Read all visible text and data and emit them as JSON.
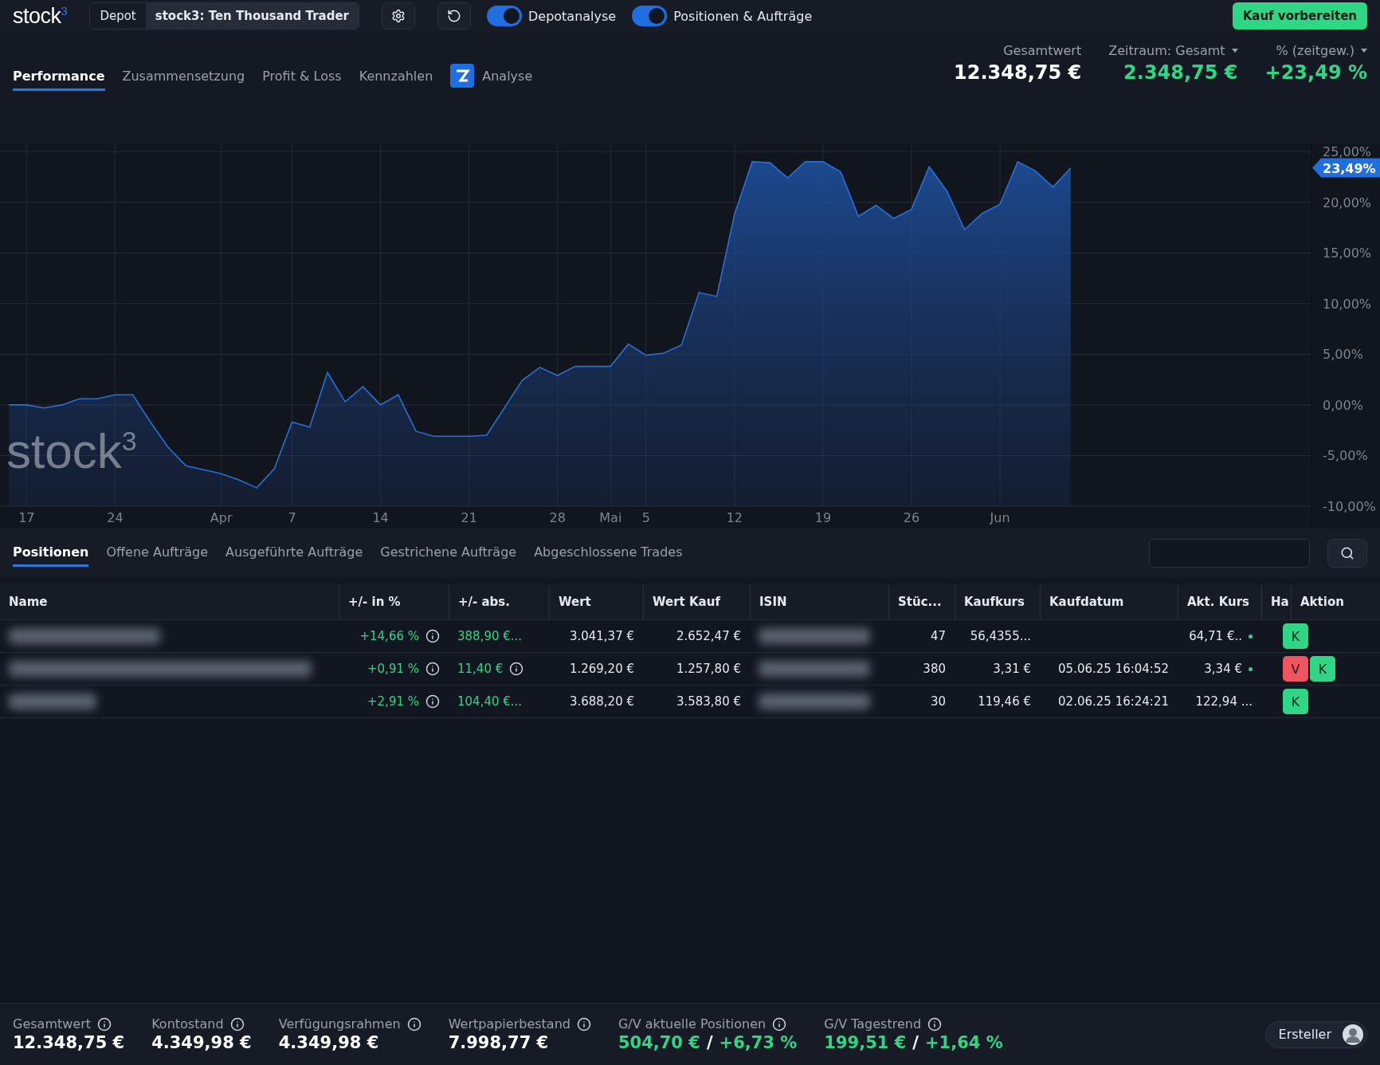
{
  "logo": "stock$^{3}$",
  "depot": {
    "label": "Depot",
    "value": "stock3: Ten Thousand Trader"
  },
  "toggles": [
    {
      "label": "Depotanalyse",
      "on": true
    },
    {
      "label": "Positionen & Aufträge",
      "on": true
    }
  ],
  "primary_button": "Kauf vorbereiten",
  "tabs": [
    {
      "label": "Performance",
      "selected": true,
      "icon": false
    },
    {
      "label": "Zusammensetzung",
      "selected": false,
      "icon": false
    },
    {
      "label": "Profit & Loss",
      "selected": false,
      "icon": false
    },
    {
      "label": "Kennzahlen",
      "selected": false,
      "icon": false
    },
    {
      "label": "Analyse",
      "selected": false,
      "icon": true
    }
  ],
  "summary": [
    {
      "label": "Gesamtwert",
      "dropdown": false,
      "value": "12.348,75 €",
      "positive": false
    },
    {
      "label": "Zeitraum: Gesamt",
      "dropdown": true,
      "value": "2.348,75 €",
      "positive": true
    },
    {
      "label": "% (zeitgew.)",
      "dropdown": true,
      "value": "+23,49 %",
      "positive": true
    }
  ],
  "chart_watermark": "stock$^{3}$",
  "chart_current_label": "23,49%",
  "chart_data": {
    "type": "line",
    "grid": true,
    "ylim": [
      -10,
      25.8
    ],
    "categories": [
      null,
      "17",
      null,
      null,
      null,
      null,
      "24",
      null,
      null,
      null,
      null,
      null,
      "Apr",
      null,
      null,
      null,
      "7",
      null,
      null,
      null,
      null,
      "14",
      null,
      null,
      null,
      null,
      "21",
      null,
      null,
      null,
      null,
      "28",
      null,
      null,
      "Mai",
      null,
      "5",
      null,
      null,
      null,
      null,
      "12",
      null,
      null,
      null,
      null,
      "19",
      null,
      null,
      null,
      null,
      "26",
      null,
      null,
      null,
      null,
      "Jun",
      null,
      null,
      null,
      null
    ],
    "series": [
      {
        "color": "#2a6fd6",
        "values": [
          0,
          0,
          -0.3,
          0,
          0.6,
          0.6,
          1.0,
          1.0,
          -1.7,
          -4.2,
          -6.0,
          -6.4,
          -6.8,
          -7.4,
          -8.2,
          -6.3,
          -1.7,
          -2.2,
          3.2,
          0.3,
          1.8,
          0,
          1.0,
          -2.6,
          -3.1,
          -3.1,
          -3.1,
          -3.0,
          -0.3,
          2.4,
          3.7,
          2.9,
          3.8,
          3.8,
          3.8,
          6.0,
          4.9,
          5.1,
          5.9,
          11.1,
          10.7,
          18.8,
          24.0,
          23.9,
          22.4,
          24.0,
          24.0,
          23.0,
          18.6,
          19.7,
          18.4,
          19.3,
          23.5,
          21.1,
          17.3,
          18.9,
          19.8,
          24.0,
          23.1,
          21.5,
          23.4
        ]
      }
    ],
    "yticks": [
      {
        "value": 25,
        "label": "25,00%"
      },
      {
        "value": 20,
        "label": "20,00%"
      },
      {
        "value": 15,
        "label": "15,00%"
      },
      {
        "value": 10,
        "label": "10,00%"
      },
      {
        "value": 5,
        "label": "5,00%"
      },
      {
        "value": 0,
        "label": "0,00%"
      },
      {
        "value": -5,
        "label": "-5,00%"
      },
      {
        "value": -10,
        "label": "-10,00%"
      }
    ]
  },
  "order_tabs": [
    {
      "label": "Positionen",
      "selected": true
    },
    {
      "label": "Offene Aufträge",
      "selected": false
    },
    {
      "label": "Ausgeführte Aufträge",
      "selected": false
    },
    {
      "label": "Gestrichene Aufträge",
      "selected": false
    },
    {
      "label": "Abgeschlossene Trades",
      "selected": false
    }
  ],
  "table": {
    "columns": [
      "Name",
      "+/- in %",
      "+/- abs.",
      "Wert",
      "Wert Kauf",
      "ISIN",
      "Stüc...",
      "Kaufkurs",
      "Kaufdatum",
      "Akt. Kurs",
      "Ha",
      "Aktion"
    ],
    "rows": [
      {
        "name_redacted": true,
        "pct": {
          "text": "+14,66 %",
          "info": true
        },
        "abs": {
          "text": "388,90 €...",
          "info": false
        },
        "wert": "3.041,37 €",
        "wert_kauf": "2.652,47 €",
        "isin_redacted": true,
        "stueck": "47",
        "kaufkurs": "56,4355...",
        "akt_kurs": "64,71 €..",
        "dot": true,
        "actions": [
          {
            "label": "K",
            "kind": "buy"
          }
        ]
      },
      {
        "name_redacted": true,
        "pct": {
          "text": "+0,91 %",
          "info": true
        },
        "abs": {
          "text": "11,40 €",
          "info": true
        },
        "wert": "1.269,20 €",
        "wert_kauf": "1.257,80 €",
        "isin_redacted": true,
        "stueck": "380",
        "kaufkurs": "3,31 €",
        "kaufdatum": "05.06.25 16:04:52",
        "akt_kurs": "3,34 €",
        "dot": true,
        "actions": [
          {
            "label": "V",
            "kind": "sell"
          },
          {
            "label": "K",
            "kind": "buy"
          }
        ]
      },
      {
        "name_redacted": true,
        "pct": {
          "text": "+2,91 %",
          "info": true
        },
        "abs": {
          "text": "104,40 €...",
          "info": false
        },
        "wert": "3.688,20 €",
        "wert_kauf": "3.583,80 €",
        "isin_redacted": true,
        "stueck": "30",
        "kaufkurs": "119,46 €",
        "kaufdatum": "02.06.25 16:24:21",
        "akt_kurs": "122,94 ...",
        "dot": false,
        "actions": [
          {
            "label": "K",
            "kind": "buy"
          }
        ]
      }
    ]
  },
  "footer": [
    {
      "label": "Gesamtwert",
      "values": [
        {
          "text": "12.348,75 €",
          "positive": false
        }
      ]
    },
    {
      "label": "Kontostand",
      "values": [
        {
          "text": "4.349,98 €",
          "positive": false
        }
      ]
    },
    {
      "label": "Verfügungsrahmen",
      "values": [
        {
          "text": "4.349,98 €",
          "positive": false
        }
      ]
    },
    {
      "label": "Wertpapierbestand",
      "values": [
        {
          "text": "7.998,77 €",
          "positive": false
        }
      ]
    },
    {
      "label": "G/V aktuelle Positionen",
      "values": [
        {
          "text": "504,70 €",
          "positive": true
        },
        {
          "text": "/",
          "positive": false
        },
        {
          "text": "+6,73 %",
          "positive": true
        }
      ]
    },
    {
      "label": "G/V Tagestrend",
      "values": [
        {
          "text": "199,51 €",
          "positive": true
        },
        {
          "text": "/",
          "positive": false
        },
        {
          "text": "+1,64 %",
          "positive": true
        }
      ]
    }
  ],
  "creator_button": "Ersteller"
}
